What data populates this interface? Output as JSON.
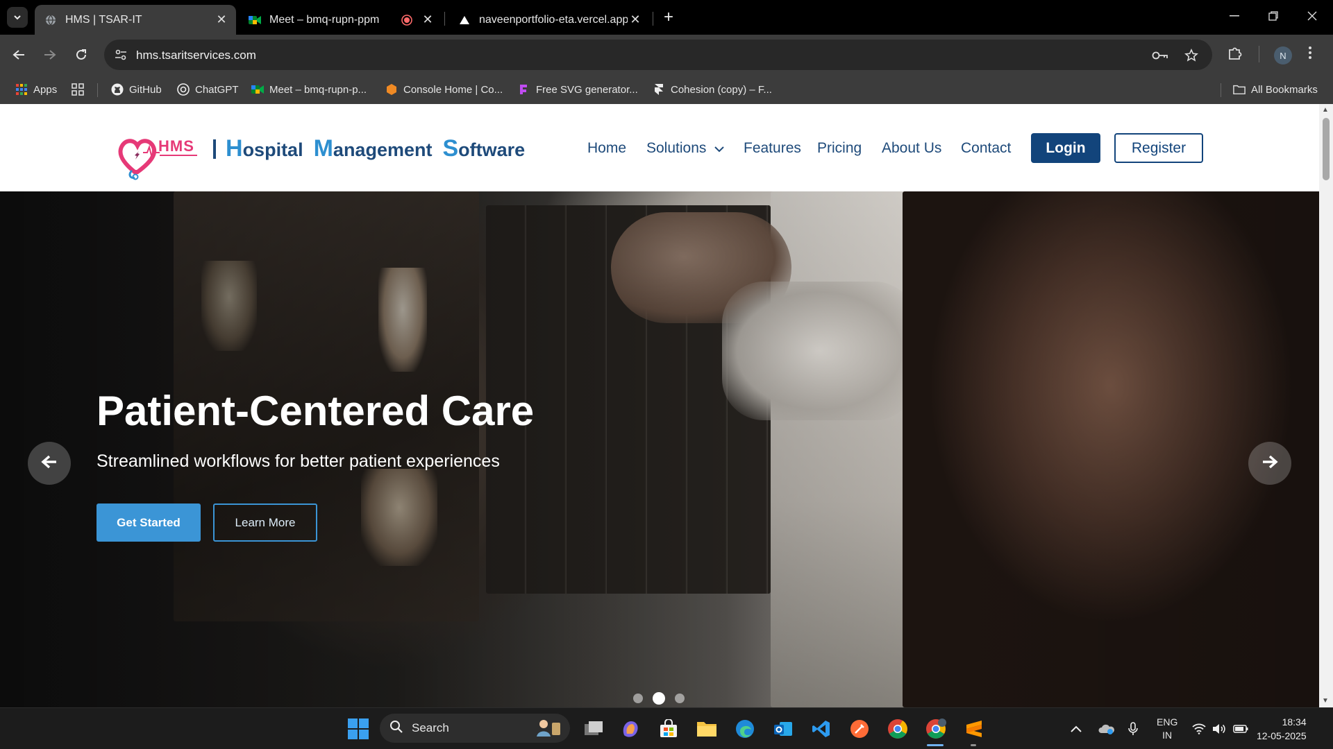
{
  "browser": {
    "tabs": [
      {
        "title": "HMS | TSAR-IT",
        "active": true
      },
      {
        "title": "Meet – bmq-rupn-ppm",
        "active": false
      },
      {
        "title": "",
        "recording": true
      },
      {
        "title": "naveenportfolio-eta.vercel.app",
        "active": false
      }
    ],
    "url": "hms.tsaritservices.com",
    "profile_initial": "N",
    "bookmarks": [
      {
        "label": "Apps",
        "icon": "apps-grid-icon"
      },
      {
        "label": "",
        "icon": "tiles-icon"
      },
      {
        "label": "GitHub",
        "icon": "github-icon"
      },
      {
        "label": "ChatGPT",
        "icon": "chatgpt-icon"
      },
      {
        "label": "Meet – bmq-rupn-p...",
        "icon": "meet-icon"
      },
      {
        "label": "Console Home | Co...",
        "icon": "aws-icon"
      },
      {
        "label": "Free SVG generator...",
        "icon": "svg-icon"
      },
      {
        "label": "Cohesion (copy) – F...",
        "icon": "framer-icon"
      }
    ],
    "all_bookmarks": "All Bookmarks"
  },
  "site": {
    "logo_text": "HMS",
    "brand": {
      "w1_cap": "H",
      "w1_rest": "ospital",
      "w2_cap": "M",
      "w2_rest": "anagement",
      "w3_cap": "S",
      "w3_rest": "oftware"
    },
    "nav": [
      "Home",
      "Solutions",
      "Features",
      "Pricing",
      "About Us",
      "Contact"
    ],
    "login": "Login",
    "register": "Register",
    "colors": {
      "primary": "#12447b",
      "accent": "#3b95d6",
      "brand_pink": "#e63977"
    }
  },
  "hero": {
    "title": "Patient-Centered Care",
    "subtitle": "Streamlined workflows for better patient experiences",
    "primary_cta": "Get Started",
    "secondary_cta": "Learn More",
    "slides": 3,
    "active_slide": 2
  },
  "taskbar": {
    "search_label": "Search",
    "apps": [
      "start-icon",
      "task-view-icon",
      "copilot-icon",
      "store-icon",
      "file-explorer-icon",
      "edge-icon",
      "outlook-icon",
      "vscode-icon",
      "postman-icon",
      "chrome-icon",
      "chrome-profile-icon",
      "sublime-icon"
    ],
    "lang_line1": "ENG",
    "lang_line2": "IN",
    "time": "18:34",
    "date": "12-05-2025"
  }
}
